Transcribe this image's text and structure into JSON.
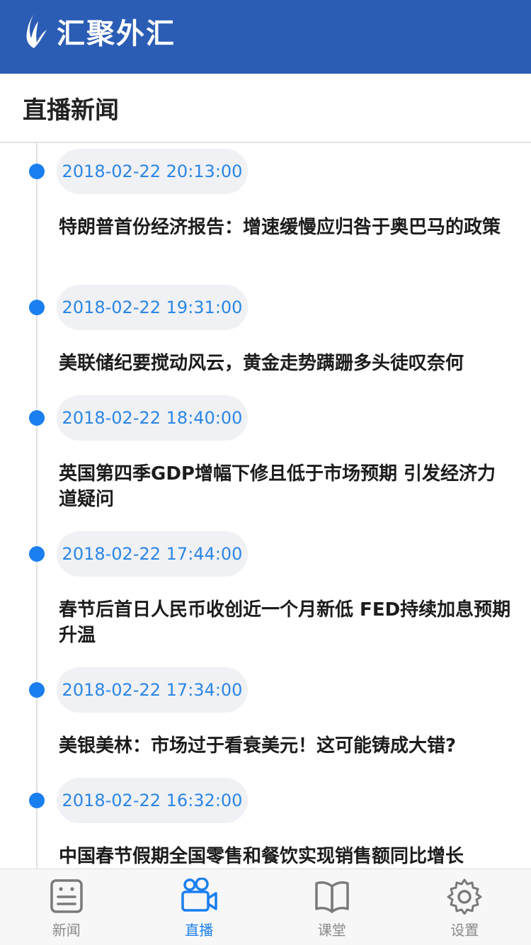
{
  "app": {
    "brand": "汇聚外汇"
  },
  "section": {
    "title": "直播新闻"
  },
  "colors": {
    "header_bg": "#2b5db5",
    "accent": "#1a7ff0",
    "time_text": "#2a86e6"
  },
  "news": [
    {
      "time": "2018-02-22 20:13:00",
      "title": "特朗普首份经济报告：增速缓慢应归咎于奥巴马的政策"
    },
    {
      "time": "2018-02-22 19:31:00",
      "title": "美联储纪要搅动风云，黄金走势蹒跚多头徒叹奈何"
    },
    {
      "time": "2018-02-22 18:40:00",
      "title": "英国第四季GDP增幅下修且低于市场预期 引发经济力道疑问"
    },
    {
      "time": "2018-02-22 17:44:00",
      "title": "春节后首日人民币收创近一个月新低 FED持续加息预期升温"
    },
    {
      "time": "2018-02-22 17:34:00",
      "title": "美银美林：市场过于看衰美元！这可能铸成大错?"
    },
    {
      "time": "2018-02-22 16:32:00",
      "title": "中国春节假期全国零售和餐饮实现销售额同比增长"
    }
  ],
  "tabbar": {
    "tabs": [
      {
        "label": "新闻",
        "icon": "news-icon",
        "active": false
      },
      {
        "label": "直播",
        "icon": "video-camera-icon",
        "active": true
      },
      {
        "label": "课堂",
        "icon": "book-icon",
        "active": false
      },
      {
        "label": "设置",
        "icon": "gear-icon",
        "active": false
      }
    ]
  }
}
